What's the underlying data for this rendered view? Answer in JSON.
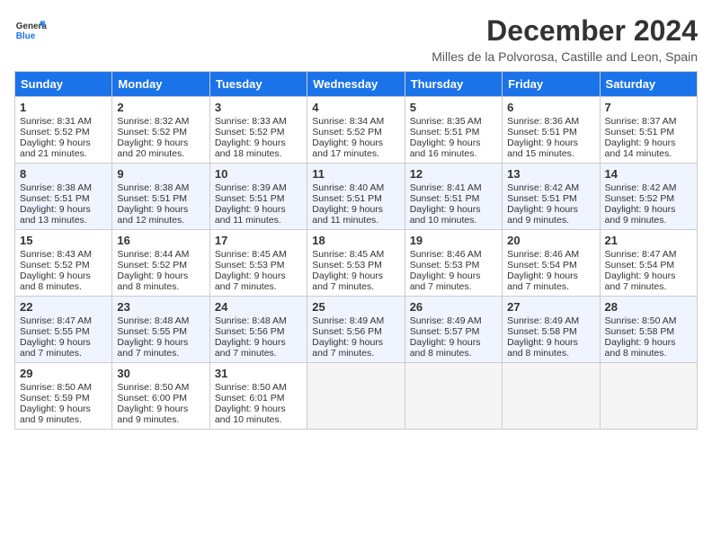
{
  "header": {
    "logo_general": "General",
    "logo_blue": "Blue",
    "month": "December 2024",
    "location": "Milles de la Polvorosa, Castille and Leon, Spain"
  },
  "weekdays": [
    "Sunday",
    "Monday",
    "Tuesday",
    "Wednesday",
    "Thursday",
    "Friday",
    "Saturday"
  ],
  "weeks": [
    {
      "shaded": false,
      "days": [
        {
          "num": "1",
          "rise": "Sunrise: 8:31 AM",
          "set": "Sunset: 5:52 PM",
          "day": "Daylight: 9 hours and 21 minutes."
        },
        {
          "num": "2",
          "rise": "Sunrise: 8:32 AM",
          "set": "Sunset: 5:52 PM",
          "day": "Daylight: 9 hours and 20 minutes."
        },
        {
          "num": "3",
          "rise": "Sunrise: 8:33 AM",
          "set": "Sunset: 5:52 PM",
          "day": "Daylight: 9 hours and 18 minutes."
        },
        {
          "num": "4",
          "rise": "Sunrise: 8:34 AM",
          "set": "Sunset: 5:52 PM",
          "day": "Daylight: 9 hours and 17 minutes."
        },
        {
          "num": "5",
          "rise": "Sunrise: 8:35 AM",
          "set": "Sunset: 5:51 PM",
          "day": "Daylight: 9 hours and 16 minutes."
        },
        {
          "num": "6",
          "rise": "Sunrise: 8:36 AM",
          "set": "Sunset: 5:51 PM",
          "day": "Daylight: 9 hours and 15 minutes."
        },
        {
          "num": "7",
          "rise": "Sunrise: 8:37 AM",
          "set": "Sunset: 5:51 PM",
          "day": "Daylight: 9 hours and 14 minutes."
        }
      ]
    },
    {
      "shaded": true,
      "days": [
        {
          "num": "8",
          "rise": "Sunrise: 8:38 AM",
          "set": "Sunset: 5:51 PM",
          "day": "Daylight: 9 hours and 13 minutes."
        },
        {
          "num": "9",
          "rise": "Sunrise: 8:38 AM",
          "set": "Sunset: 5:51 PM",
          "day": "Daylight: 9 hours and 12 minutes."
        },
        {
          "num": "10",
          "rise": "Sunrise: 8:39 AM",
          "set": "Sunset: 5:51 PM",
          "day": "Daylight: 9 hours and 11 minutes."
        },
        {
          "num": "11",
          "rise": "Sunrise: 8:40 AM",
          "set": "Sunset: 5:51 PM",
          "day": "Daylight: 9 hours and 11 minutes."
        },
        {
          "num": "12",
          "rise": "Sunrise: 8:41 AM",
          "set": "Sunset: 5:51 PM",
          "day": "Daylight: 9 hours and 10 minutes."
        },
        {
          "num": "13",
          "rise": "Sunrise: 8:42 AM",
          "set": "Sunset: 5:51 PM",
          "day": "Daylight: 9 hours and 9 minutes."
        },
        {
          "num": "14",
          "rise": "Sunrise: 8:42 AM",
          "set": "Sunset: 5:52 PM",
          "day": "Daylight: 9 hours and 9 minutes."
        }
      ]
    },
    {
      "shaded": false,
      "days": [
        {
          "num": "15",
          "rise": "Sunrise: 8:43 AM",
          "set": "Sunset: 5:52 PM",
          "day": "Daylight: 9 hours and 8 minutes."
        },
        {
          "num": "16",
          "rise": "Sunrise: 8:44 AM",
          "set": "Sunset: 5:52 PM",
          "day": "Daylight: 9 hours and 8 minutes."
        },
        {
          "num": "17",
          "rise": "Sunrise: 8:45 AM",
          "set": "Sunset: 5:53 PM",
          "day": "Daylight: 9 hours and 7 minutes."
        },
        {
          "num": "18",
          "rise": "Sunrise: 8:45 AM",
          "set": "Sunset: 5:53 PM",
          "day": "Daylight: 9 hours and 7 minutes."
        },
        {
          "num": "19",
          "rise": "Sunrise: 8:46 AM",
          "set": "Sunset: 5:53 PM",
          "day": "Daylight: 9 hours and 7 minutes."
        },
        {
          "num": "20",
          "rise": "Sunrise: 8:46 AM",
          "set": "Sunset: 5:54 PM",
          "day": "Daylight: 9 hours and 7 minutes."
        },
        {
          "num": "21",
          "rise": "Sunrise: 8:47 AM",
          "set": "Sunset: 5:54 PM",
          "day": "Daylight: 9 hours and 7 minutes."
        }
      ]
    },
    {
      "shaded": true,
      "days": [
        {
          "num": "22",
          "rise": "Sunrise: 8:47 AM",
          "set": "Sunset: 5:55 PM",
          "day": "Daylight: 9 hours and 7 minutes."
        },
        {
          "num": "23",
          "rise": "Sunrise: 8:48 AM",
          "set": "Sunset: 5:55 PM",
          "day": "Daylight: 9 hours and 7 minutes."
        },
        {
          "num": "24",
          "rise": "Sunrise: 8:48 AM",
          "set": "Sunset: 5:56 PM",
          "day": "Daylight: 9 hours and 7 minutes."
        },
        {
          "num": "25",
          "rise": "Sunrise: 8:49 AM",
          "set": "Sunset: 5:56 PM",
          "day": "Daylight: 9 hours and 7 minutes."
        },
        {
          "num": "26",
          "rise": "Sunrise: 8:49 AM",
          "set": "Sunset: 5:57 PM",
          "day": "Daylight: 9 hours and 8 minutes."
        },
        {
          "num": "27",
          "rise": "Sunrise: 8:49 AM",
          "set": "Sunset: 5:58 PM",
          "day": "Daylight: 9 hours and 8 minutes."
        },
        {
          "num": "28",
          "rise": "Sunrise: 8:50 AM",
          "set": "Sunset: 5:58 PM",
          "day": "Daylight: 9 hours and 8 minutes."
        }
      ]
    },
    {
      "shaded": false,
      "days": [
        {
          "num": "29",
          "rise": "Sunrise: 8:50 AM",
          "set": "Sunset: 5:59 PM",
          "day": "Daylight: 9 hours and 9 minutes."
        },
        {
          "num": "30",
          "rise": "Sunrise: 8:50 AM",
          "set": "Sunset: 6:00 PM",
          "day": "Daylight: 9 hours and 9 minutes."
        },
        {
          "num": "31",
          "rise": "Sunrise: 8:50 AM",
          "set": "Sunset: 6:01 PM",
          "day": "Daylight: 9 hours and 10 minutes."
        },
        null,
        null,
        null,
        null
      ]
    }
  ]
}
